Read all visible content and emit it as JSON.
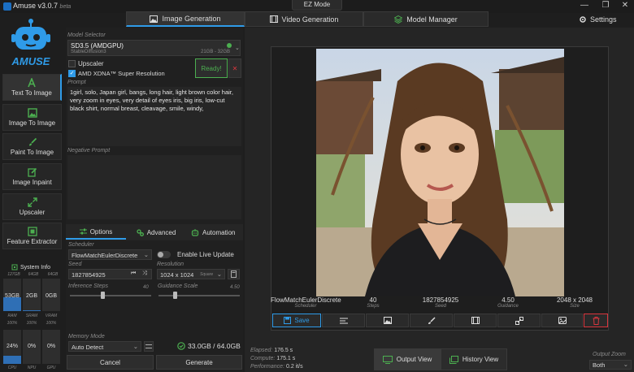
{
  "window": {
    "title": "Amuse v3.0.7",
    "beta": "beta",
    "ez_mode": "EZ Mode",
    "minimize": "—",
    "maximize": "❐",
    "close": "✕"
  },
  "top_tabs": [
    {
      "label": "Image Generation",
      "active": true
    },
    {
      "label": "Video Generation",
      "active": false
    },
    {
      "label": "Model Manager",
      "active": false
    }
  ],
  "settings_label": "Settings",
  "sidebar": {
    "items": [
      {
        "label": "Text To Image",
        "icon": "text-icon",
        "active": true
      },
      {
        "label": "Image To Image",
        "icon": "image-icon",
        "active": false
      },
      {
        "label": "Paint To Image",
        "icon": "brush-icon",
        "active": false
      },
      {
        "label": "Image Inpaint",
        "icon": "edit-icon",
        "active": false
      },
      {
        "label": "Upscaler",
        "icon": "expand-icon",
        "active": false
      },
      {
        "label": "Feature Extractor",
        "icon": "extract-icon",
        "active": false
      }
    ]
  },
  "system_info": {
    "title": "System Info",
    "totals": [
      "127GB",
      "64GB",
      "64GB"
    ],
    "used": [
      "53GB",
      "2GB",
      "0GB"
    ],
    "mem_labels": [
      "RAM",
      "SRAM",
      "VRAM"
    ],
    "mem_pct": [
      "100%",
      "100%",
      "100%"
    ],
    "mem_fill": [
      0.42,
      0.03,
      0.0
    ],
    "proc_values": [
      "24%",
      "0%",
      "0%"
    ],
    "proc_labels": [
      "CPU",
      "NPU",
      "GPU"
    ],
    "proc_fill": [
      0.24,
      0.0,
      0.0
    ]
  },
  "model_selector": {
    "label": "Model Selector",
    "model": "SD3.5 (AMDGPU)",
    "subtitle": "StableDiffusion3",
    "memory": "21GB - 32GB",
    "status_color": "#4caf50",
    "upscaler_label": "Upscaler",
    "upscaler_checked": false,
    "xdna_label": "AMD XDNA™ Super Resolution",
    "xdna_checked": true,
    "ready_label": "Ready!",
    "unload": "✕"
  },
  "prompt": {
    "label": "Prompt",
    "text": "1girl, solo, Japan girl, bangs, long hair, light brown color hair, very zoom in eyes, very detail of eyes iris, big iris, low-cut black shirt, normal breast, cleavage, smile, windy,"
  },
  "negative_prompt": {
    "label": "Negative Prompt",
    "text": ""
  },
  "sub_tabs": [
    {
      "label": "Options",
      "active": true
    },
    {
      "label": "Advanced",
      "active": false
    },
    {
      "label": "Automation",
      "active": false
    }
  ],
  "options": {
    "scheduler_label": "Scheduler",
    "scheduler": "FlowMatchEulerDiscrete",
    "live_update_label": "Enable Live Update",
    "live_update_on": false,
    "seed_label": "Seed",
    "seed": "1827854925",
    "resolution_label": "Resolution",
    "resolution": "1024 x 1024",
    "resolution_tag": "Square",
    "steps_label": "Inference Steps",
    "steps": "40",
    "steps_fill": 0.4,
    "guidance_label": "Guidance Scale",
    "guidance": "4.50",
    "guidance_fill": 0.2,
    "memory_mode_label": "Memory Mode",
    "memory_mode": "Auto Detect",
    "memory_usage": "33.0GB / 64.0GB"
  },
  "actions": {
    "cancel": "Cancel",
    "generate": "Generate"
  },
  "result": {
    "meta": [
      {
        "value": "FlowMatchEulerDiscrete",
        "label": "Scheduler"
      },
      {
        "value": "40",
        "label": "Steps"
      },
      {
        "value": "1827854925",
        "label": "Seed"
      },
      {
        "value": "4.50",
        "label": "Guidance"
      },
      {
        "value": "2048 x 2048",
        "label": "Size"
      }
    ],
    "save_label": "Save",
    "tool_icons": [
      "align-icon",
      "image-icon",
      "brush-icon",
      "film-icon",
      "link-icon",
      "gallery-icon",
      "delete-icon"
    ]
  },
  "status": {
    "elapsed_label": "Elapsed:",
    "elapsed": "176.5 s",
    "compute_label": "Compute:",
    "compute": "175.1 s",
    "performance_label": "Performance:",
    "performance": "0.2 it/s"
  },
  "views": {
    "output": "Output View",
    "history": "History View"
  },
  "output_zoom": {
    "label": "Output Zoom",
    "value": "Both"
  },
  "colors": {
    "accent": "#2f9be8",
    "danger": "#d9363e",
    "ready": "#4caf50"
  }
}
